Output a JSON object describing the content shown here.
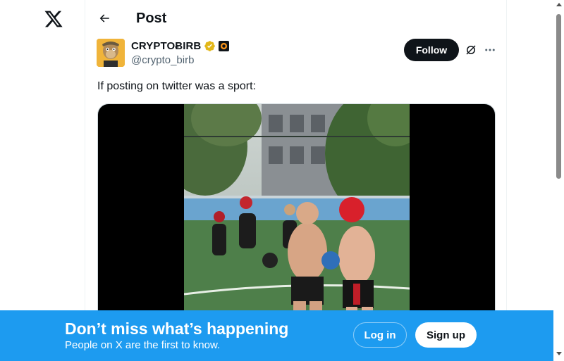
{
  "nav": {
    "logo_icon": "x-logo-icon"
  },
  "header": {
    "back_icon": "arrow-left-icon",
    "title": "Post"
  },
  "post": {
    "display_name": "CRYPTOɃIRB",
    "handle": "@crypto_birb",
    "verified_icon": "verified-badge-gold-icon",
    "affiliation_icon": "affiliate-badge-icon",
    "follow_label": "Follow",
    "grok_icon": "grok-icon",
    "more_icon": "more-dots-icon",
    "text": "If posting on twitter was a sport:",
    "media_type": "video"
  },
  "banner": {
    "title": "Don’t miss what’s happening",
    "subtitle": "People on X are the first to know.",
    "login_label": "Log in",
    "signup_label": "Sign up"
  },
  "colors": {
    "accent": "#1d9bf0",
    "text": "#0f1419",
    "secondary_text": "#536471",
    "verified_gold": "#e2b719"
  }
}
